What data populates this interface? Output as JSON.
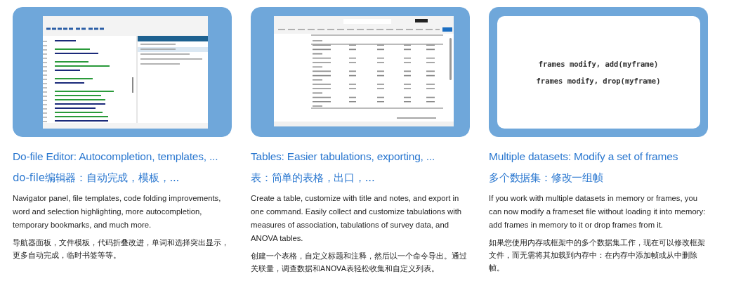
{
  "cards": [
    {
      "title": "Do-file Editor: Autocompletion, templates, ...",
      "title_zh": "do-file编辑器：自动完成，模板，...",
      "description": "Navigator panel, file templates, code folding improvements, word and selection highlighting, more autocompletion, temporary bookmarks, and much more.",
      "description_zh": "导航器面板，文件模板，代码折叠改进，单词和选择突出显示，更多自动完成，临时书签等等。"
    },
    {
      "title": "Tables: Easier tabulations, exporting, ...",
      "title_zh": "表：简单的表格，出口，...",
      "description": "Create a table, customize with title and notes, and export in one command. Easily collect and customize tabulations with measures of association, tabulations of survey data, and ANOVA tables.",
      "description_zh": "创建一个表格，自定义标题和注释，然后以一个命令导出。通过关联量，调查数据和ANOVA表轻松收集和自定义列表。"
    },
    {
      "image": {
        "kind": "code",
        "lines": [
          "frames modify, add(myframe)",
          "frames modify, drop(myframe)"
        ]
      },
      "title": "Multiple datasets: Modify a set of frames",
      "title_zh": "多个数据集：修改一组帧",
      "description": "If you work with multiple datasets in memory or frames, you can now modify a frameset file without loading it into memory: add frames in memory to it or drop frames from it.",
      "description_zh": "如果您使用内存或框架中的多个数据集工作，现在可以修改框架文件，而无需将其加载到内存中：在内存中添加帧或从中删除帧。"
    }
  ]
}
